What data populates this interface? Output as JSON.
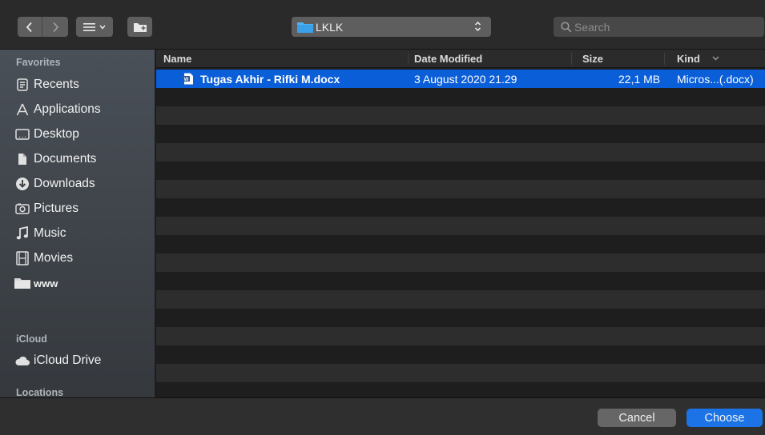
{
  "toolbar": {
    "back_icon": "chevron-left-icon",
    "forward_icon": "chevron-right-icon",
    "view_icon": "list-view-icon",
    "new_folder_icon": "new-folder-icon",
    "location": "LKLK",
    "search_placeholder": "Search"
  },
  "sidebar": {
    "favorites_heading": "Favorites",
    "favorites": [
      {
        "label": "Recents",
        "icon": "recents-icon"
      },
      {
        "label": "Applications",
        "icon": "applications-icon"
      },
      {
        "label": "Desktop",
        "icon": "desktop-icon"
      },
      {
        "label": "Documents",
        "icon": "documents-icon"
      },
      {
        "label": "Downloads",
        "icon": "downloads-icon"
      },
      {
        "label": "Pictures",
        "icon": "pictures-icon"
      },
      {
        "label": "Music",
        "icon": "music-icon"
      },
      {
        "label": "Movies",
        "icon": "movies-icon"
      },
      {
        "label": "www",
        "icon": "folder-icon"
      }
    ],
    "icloud_heading": "iCloud",
    "icloud": [
      {
        "label": "iCloud Drive",
        "icon": "cloud-icon"
      }
    ],
    "locations_heading": "Locations"
  },
  "columns": {
    "name": "Name",
    "date_modified": "Date Modified",
    "size": "Size",
    "kind": "Kind"
  },
  "files": [
    {
      "name": "Tugas Akhir - Rifki M.docx",
      "date_modified": "3 August 2020 21.29",
      "size": "22,1 MB",
      "kind": "Micros...(.docx)",
      "icon": "word-document-icon",
      "selected": true
    }
  ],
  "buttons": {
    "cancel": "Cancel",
    "choose": "Choose"
  },
  "colors": {
    "selection": "#0a5ed8",
    "primary_button": "#1b73e6",
    "folder_accent": "#3aa0e8"
  }
}
